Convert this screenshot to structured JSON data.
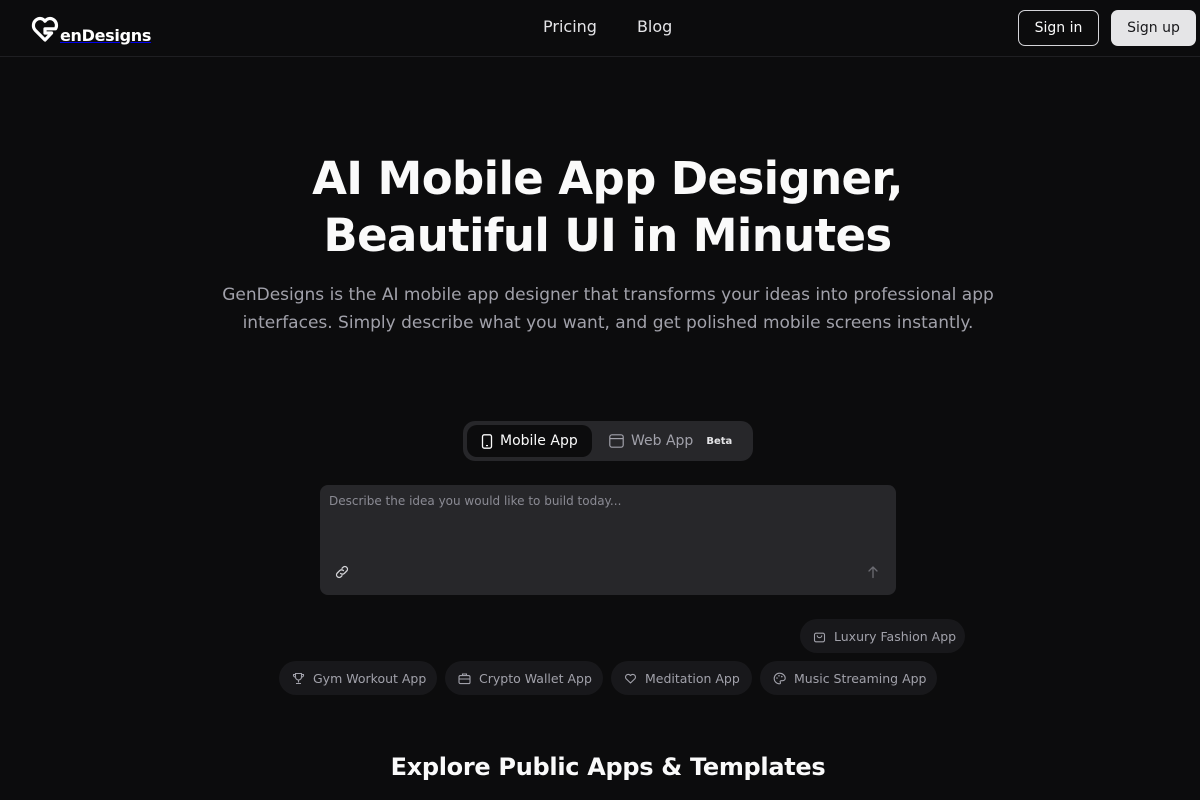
{
  "brand": {
    "name_text": "enDesigns",
    "logo_icon": "heart-g-logo-icon"
  },
  "nav": {
    "pricing": "Pricing",
    "blog": "Blog"
  },
  "auth": {
    "signin": "Sign in",
    "signup": "Sign up"
  },
  "hero": {
    "title_line1": "AI Mobile App Designer,",
    "title_line2": "Beautiful UI in Minutes",
    "subtitle": "GenDesigns is the AI mobile app designer that transforms your ideas into professional app interfaces. Simply describe what you want, and get polished mobile screens instantly."
  },
  "mode_toggle": {
    "options": [
      {
        "label": "Mobile App",
        "icon": "smartphone-icon",
        "selected": true
      },
      {
        "label": "Web App",
        "icon": "browser-window-icon",
        "badge": "Beta",
        "selected": false
      }
    ]
  },
  "prompt": {
    "placeholder": "Describe the idea you would like to build today...",
    "value": "",
    "attach_icon": "link-icon",
    "send_icon": "arrow-up-icon"
  },
  "suggestions": [
    {
      "label": "Luxury Fashion App",
      "icon": "shopping-bag-icon"
    },
    {
      "label": "Gym Workout App",
      "icon": "trophy-icon"
    },
    {
      "label": "Crypto Wallet App",
      "icon": "briefcase-icon"
    },
    {
      "label": "Meditation App",
      "icon": "heart-icon"
    },
    {
      "label": "Music Streaming App",
      "icon": "palette-icon"
    }
  ],
  "explore": {
    "title": "Explore Public Apps & Templates",
    "subtitle": ""
  },
  "colors": {
    "background": "#0c0c0d",
    "surface": "#27272a",
    "chip": "#18181b",
    "muted_text": "#a1a1aa",
    "primary_button": "#e5e5e7"
  }
}
